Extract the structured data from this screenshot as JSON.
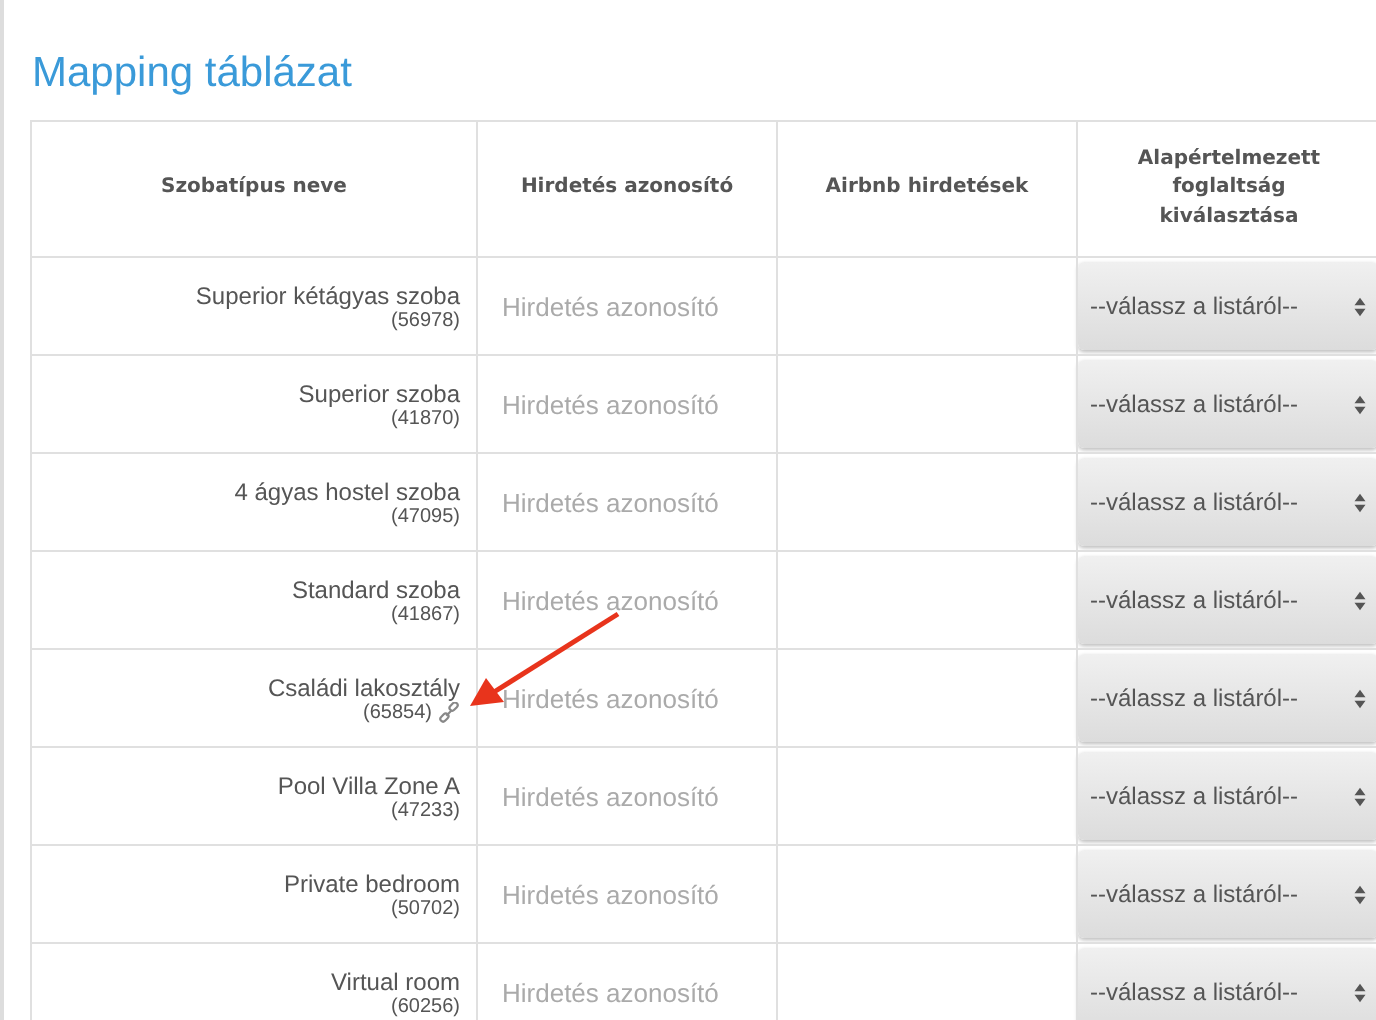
{
  "title": "Mapping táblázat",
  "table": {
    "columns": [
      "Szobatípus neve",
      "Hirdetés azonosító",
      "Airbnb hirdetések",
      "Alapértelmezett foglaltság kiválasztása"
    ],
    "rows": [
      {
        "name": "Superior kétágyas szoba",
        "id": "(56978)",
        "linked": false,
        "placeholder": "Hirdetés azonosító",
        "select": "--válassz a listáról--"
      },
      {
        "name": "Superior szoba",
        "id": "(41870)",
        "linked": false,
        "placeholder": "Hirdetés azonosító",
        "select": "--válassz a listáról--"
      },
      {
        "name": "4 ágyas hostel szoba",
        "id": "(47095)",
        "linked": false,
        "placeholder": "Hirdetés azonosító",
        "select": "--válassz a listáról--"
      },
      {
        "name": "Standard szoba",
        "id": "(41867)",
        "linked": false,
        "placeholder": "Hirdetés azonosító",
        "select": "--válassz a listáról--"
      },
      {
        "name": "Családi lakosztály",
        "id": "(65854)",
        "linked": true,
        "placeholder": "Hirdetés azonosító",
        "select": "--válassz a listáról--"
      },
      {
        "name": "Pool Villa Zone A",
        "id": "(47233)",
        "linked": false,
        "placeholder": "Hirdetés azonosító",
        "select": "--válassz a listáról--"
      },
      {
        "name": "Private bedroom",
        "id": "(50702)",
        "linked": false,
        "placeholder": "Hirdetés azonosító",
        "select": "--válassz a listáról--"
      },
      {
        "name": "Virtual room",
        "id": "(60256)",
        "linked": false,
        "placeholder": "Hirdetés azonosító",
        "select": "--válassz a listáról--"
      }
    ]
  }
}
